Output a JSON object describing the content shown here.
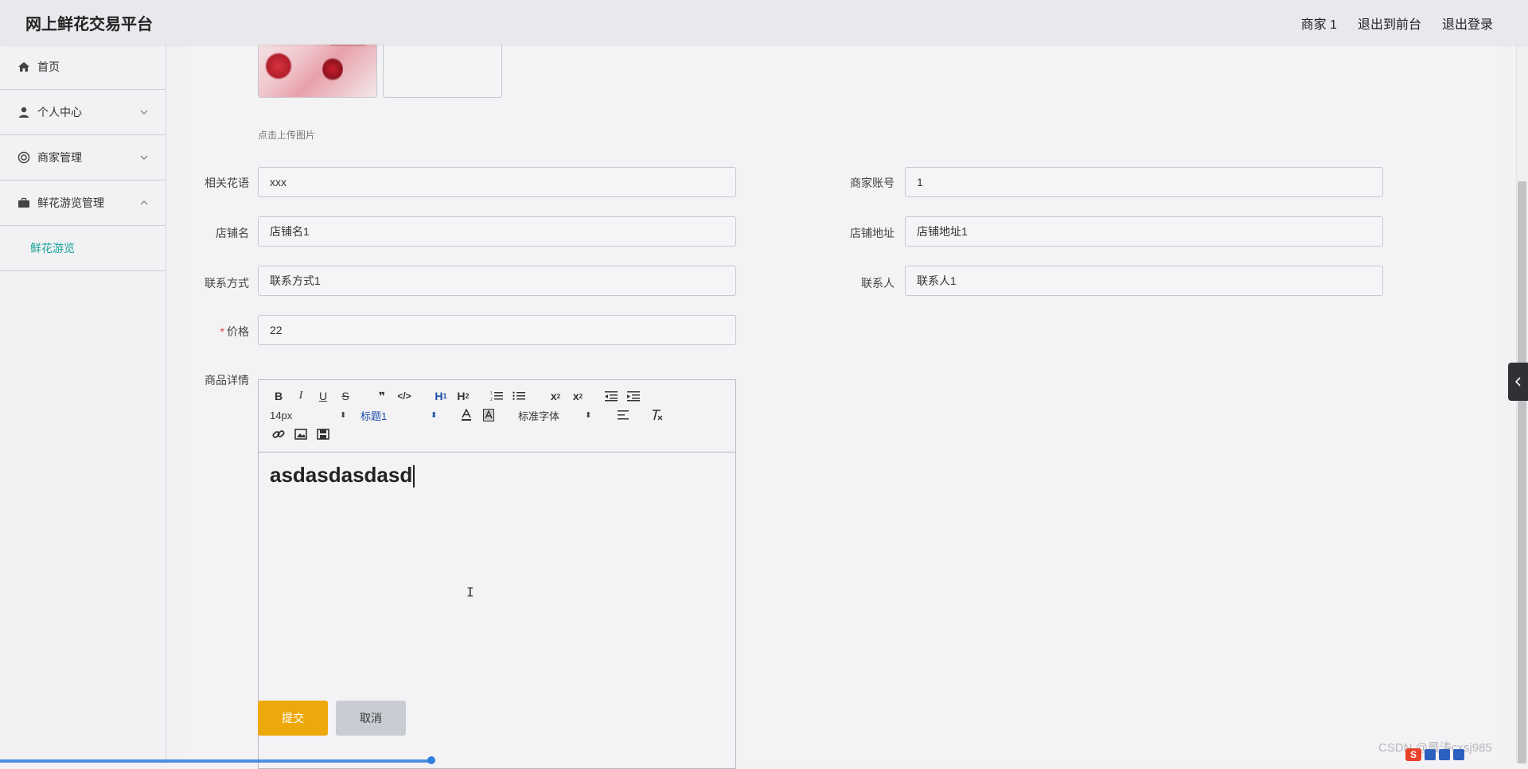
{
  "header": {
    "app_title": "网上鲜花交易平台",
    "user": "商家 1",
    "exit_front": "退出到前台",
    "logout": "退出登录"
  },
  "sidebar": {
    "items": [
      {
        "label": "首页",
        "icon": "home-icon"
      },
      {
        "label": "个人中心",
        "icon": "user-icon"
      },
      {
        "label": "商家管理",
        "icon": "lifebuoy-icon"
      },
      {
        "label": "鲜花游览管理",
        "icon": "briefcase-icon"
      }
    ],
    "sub_item": "鲜花游览"
  },
  "upload": {
    "hint": "点击上传图片"
  },
  "form": {
    "flower_language": {
      "label": "相关花语",
      "value": "xxx"
    },
    "merchant_account": {
      "label": "商家账号",
      "value": "1"
    },
    "shop_name": {
      "label": "店铺名",
      "value": "店铺名1"
    },
    "shop_address": {
      "label": "店铺地址",
      "value": "店铺地址1"
    },
    "contact_method": {
      "label": "联系方式",
      "value": "联系方式1"
    },
    "contact_person": {
      "label": "联系人",
      "value": "联系人1"
    },
    "price": {
      "label": "价格",
      "required_mark": "*",
      "value": "22"
    },
    "details": {
      "label": "商品详情"
    }
  },
  "editor": {
    "font_size": "14px",
    "heading": "标题1",
    "font_family": "标准字体",
    "content": "asdasdasdasd"
  },
  "buttons": {
    "submit": "提交",
    "cancel": "取消"
  },
  "watermark": "CSDN @晨涛cxsj985",
  "colors": {
    "accent_teal": "#17a39a",
    "submit_bg": "#eda80c",
    "cancel_bg": "#c9ccd3",
    "required": "#e04040"
  }
}
